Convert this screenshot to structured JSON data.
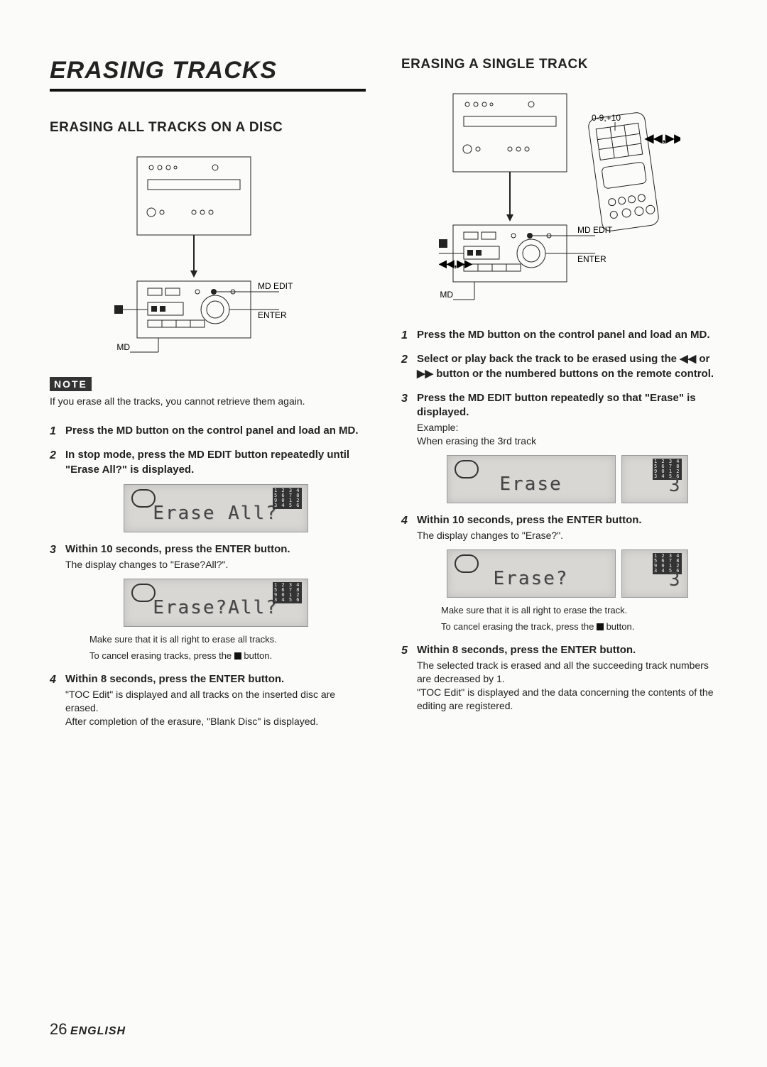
{
  "main_title": "ERASING TRACKS",
  "left": {
    "subtitle": "ERASING ALL TRACKS ON A DISC",
    "diagram_labels": {
      "md_edit": "MD EDIT",
      "enter": "ENTER",
      "md": "MD",
      "stop": "■"
    },
    "note_tag": "NOTE",
    "note_text": "If you erase all the tracks, you cannot retrieve them again.",
    "steps": [
      {
        "n": "1",
        "head": "Press the MD button on the control panel and load an MD.",
        "body": ""
      },
      {
        "n": "2",
        "head": "In stop mode, press the MD EDIT button repeatedly until \"Erase All?\" is displayed.",
        "body": "",
        "lcd_main": "Erase All?",
        "lcd_grid": "1 2 3 4\n5 6 7 8\n9 0 1 2\n3 4 5 6"
      },
      {
        "n": "3",
        "head": "Within 10 seconds, press the ENTER button.",
        "body": "The display changes to \"Erase?All?\".",
        "lcd_main": "Erase?All?",
        "lcd_grid": "1 2 3 4\n5 6 7 8\n9 0 1 2\n3 4 5 6",
        "foot1": "Make sure that it is all right to erase all tracks.",
        "foot2_a": "To cancel erasing tracks, press the ",
        "foot2_b": " button."
      },
      {
        "n": "4",
        "head": "Within 8 seconds, press the ENTER button.",
        "body": "\"TOC Edit\" is displayed and all tracks on the inserted disc are erased.\nAfter completion of the erasure, \"Blank Disc\" is displayed."
      }
    ]
  },
  "right": {
    "subtitle": "ERASING A SINGLE TRACK",
    "diagram_labels": {
      "numkeys": "0-9,+10",
      "rewff_top": "◀◀,▶▶",
      "md_edit": "MD EDIT",
      "enter": "ENTER",
      "md": "MD",
      "stop": "■",
      "rewff_side": "◀◀,▶▶"
    },
    "steps": [
      {
        "n": "1",
        "head": "Press the MD button on the control panel and load an MD.",
        "body": ""
      },
      {
        "n": "2",
        "head_a": "Select or play back the track to be erased using the ",
        "head_rew": "◀◀",
        "head_or": " or ",
        "head_ff": "▶▶",
        "head_b": " button or the numbered buttons on the remote control.",
        "body": ""
      },
      {
        "n": "3",
        "head": "Press the MD EDIT button repeatedly so that \"Erase\" is displayed.",
        "body": "Example:\nWhen erasing the 3rd track",
        "lcd_main": "Erase",
        "lcd_right": "3",
        "lcd_grid": "1 2 3 4\n5 6 7 8\n9 0 1 2\n3 4 5 6"
      },
      {
        "n": "4",
        "head": "Within 10 seconds, press the ENTER button.",
        "body": "The display changes to \"Erase?\".",
        "lcd_main": "Erase?",
        "lcd_right": "3",
        "lcd_grid": "1 2 3 4\n5 6 7 8\n9 0 1 2\n3 4 5 6",
        "foot1": "Make sure that it is all right to erase the track.",
        "foot2_a": "To cancel erasing the track, press the ",
        "foot2_b": " button."
      },
      {
        "n": "5",
        "head": "Within 8 seconds, press the ENTER button.",
        "body": "The selected track is erased and all the succeeding track numbers are decreased by 1.\n\"TOC Edit\" is displayed and the data concerning the contents of the editing are registered."
      }
    ]
  },
  "footer": {
    "page_num": "26",
    "lang": "ENGLISH"
  }
}
